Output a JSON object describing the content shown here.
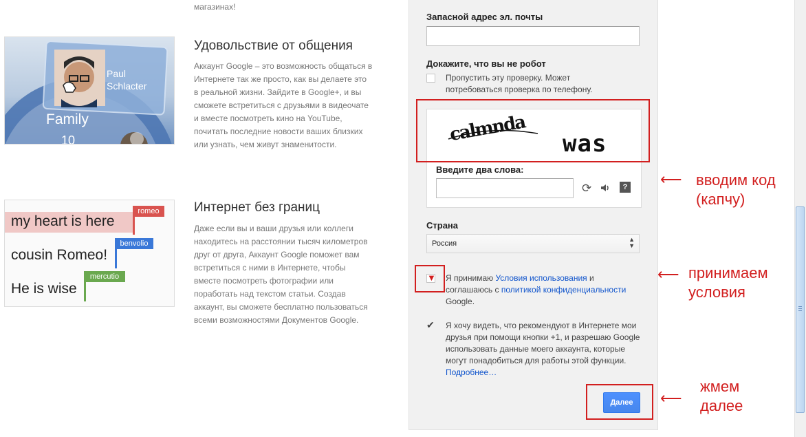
{
  "left": {
    "top_text": "магазинах!",
    "feature1": {
      "title": "Удовольствие от общения",
      "text": "Аккаунт Google – это возможность общаться в Интернете так же просто, как вы делаете это в реальной жизни. Зайдите в Google+, и вы сможете встретиться с друзьями в видеочате и вместе посмотреть кино на YouTube, почитать последние новости ваших близких или узнать, чем живут знаменитости.",
      "image": {
        "name_first": "Paul",
        "name_last": "Schlacter",
        "circle_label": "Family",
        "circle_count": "10"
      }
    },
    "feature2": {
      "title": "Интернет без границ",
      "text": "Даже если вы и ваши друзья или коллеги находитесь на расстоянии тысяч километров друг от друга, Аккаунт Google поможет вам встретиться с ними в Интернете, чтобы вместе посмотреть фотографии или поработать над текстом статьи. Создав аккаунт, вы сможете бесплатно пользоваться всеми возможностями Документов Google.",
      "image": {
        "lines": [
          {
            "text": "my heart is here",
            "tag": "romeo",
            "color": "#d9534f"
          },
          {
            "text": "cousin Romeo!",
            "tag": "benvolio",
            "color": "#3a78d8"
          },
          {
            "text": "He is wise",
            "tag": "mercutio",
            "color": "#6aa84f"
          }
        ]
      }
    }
  },
  "form": {
    "backup_email_label": "Запасной адрес эл. почты",
    "backup_email_value": "",
    "robot_label": "Докажите, что вы не робот",
    "skip_check_text": "Пропустить эту проверку. Может потребоваться проверка по телефону.",
    "captcha": {
      "word1": "calmnda",
      "word2": "was",
      "prompt": "Введите два слова:",
      "value": ""
    },
    "country_label": "Страна",
    "country_value": "Россия",
    "terms": {
      "prefix": "Я принимаю ",
      "terms_link": "Условия использования",
      "middle": " и соглашаюсь с ",
      "privacy_link": "политикой конфиденциальности",
      "suffix": " Google."
    },
    "plusone": {
      "text": "Я хочу видеть, что рекомендуют в Интернете мои друзья при помощи кнопки +1, и разрешаю Google использовать данные моего аккаунта, которые могут понадобиться для работы этой функции. ",
      "more_link": "Подробнее…"
    },
    "next_button": "Далее"
  },
  "annotations": {
    "captcha_note": "вводим код (капчу)",
    "terms_note": "принимаем условия",
    "next_note": "жмем далее",
    "arrow": "⟵"
  },
  "colors": {
    "annotation_red": "#d21f1f",
    "link_blue": "#1155cc",
    "button_blue": "#4d90fe"
  }
}
